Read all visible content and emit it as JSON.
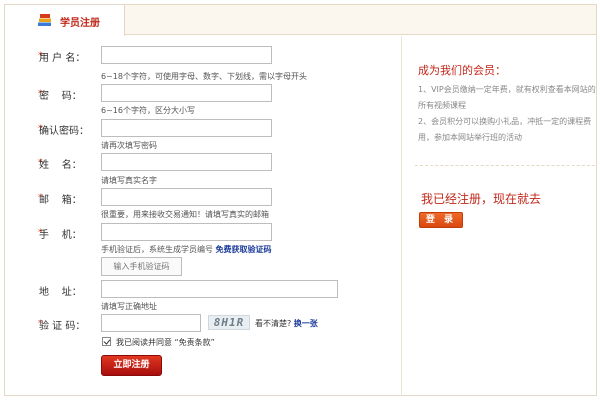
{
  "header": {
    "title": "学员注册"
  },
  "form": {
    "username": {
      "label": "用 户 名：",
      "value": "",
      "hint": "6~18个字符，可使用字母、数字、下划线，需以字母开头"
    },
    "password": {
      "label": "密    码：",
      "value": "",
      "hint": "6~16个字符，区分大小写"
    },
    "confirm": {
      "label": "确认密码：",
      "value": "",
      "hint": "请再次填写密码"
    },
    "name": {
      "label": "姓    名：",
      "value": "",
      "hint": "请填写真实名字"
    },
    "email": {
      "label": "邮    箱：",
      "value": "",
      "hint": "很重要，用来接收交易通知！请填写真实的邮箱"
    },
    "mobile": {
      "label": "手    机：",
      "value": "",
      "hint": "手机验证后，系统生成学员编号",
      "hint_link": "免费获取验证码",
      "sms_placeholder": "输入手机验证码"
    },
    "address": {
      "label": "地    址：",
      "value": "",
      "hint": "请填写正确地址"
    },
    "captcha": {
      "label": "验 证 码：",
      "value": "",
      "image_text": "8H1R",
      "question": "看不清楚?",
      "refresh": "换一张"
    },
    "agree": {
      "checked": true,
      "text": "我已阅读并同意 “免责条款”"
    },
    "submit_label": "立即注册"
  },
  "sidebar": {
    "title": "成为我们的会员：",
    "items": [
      "1、VIP会员缴纳一定年费，就有权利查看本网站的所有视频课程",
      "2、会员积分可以换购小礼品，冲抵一定的课程费用，参加本网站举行班的活动"
    ],
    "already": "我已经注册，现在就去",
    "login_label": "登 录"
  },
  "colors": {
    "accent_red": "#c0281b",
    "login_orange": "#e8591c",
    "border_tan": "#e3d9c6"
  }
}
